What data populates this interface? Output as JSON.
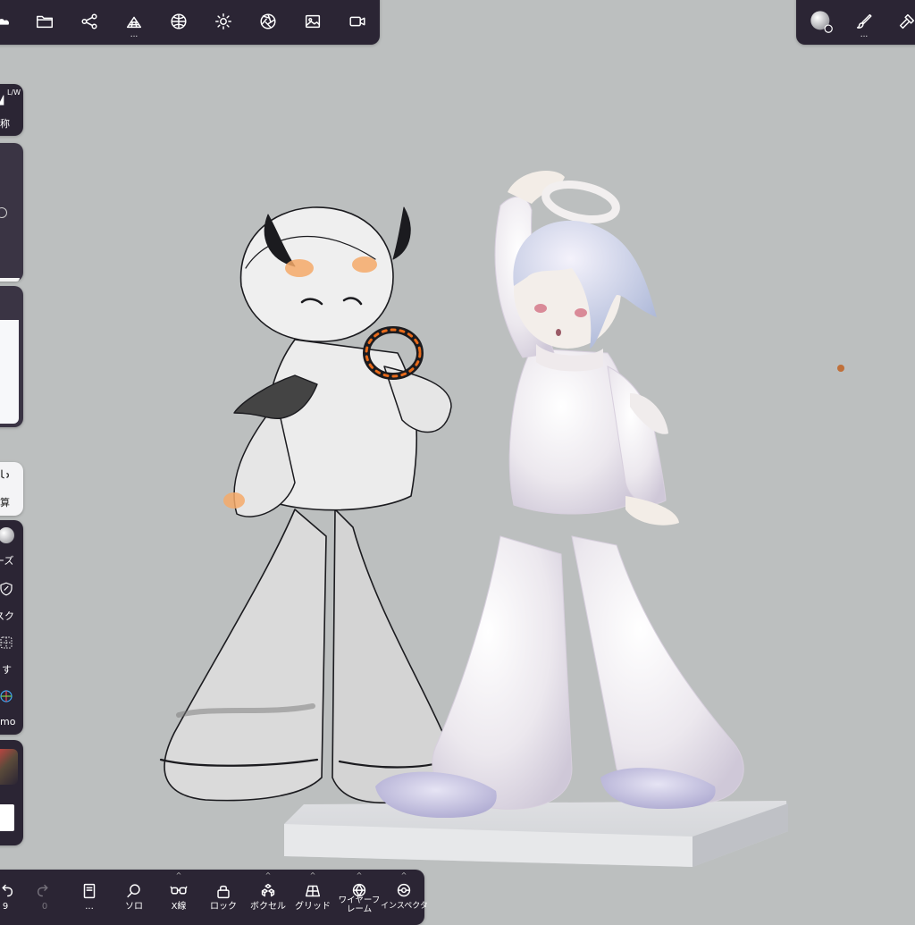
{
  "colors": {
    "background": "#bcbfbf",
    "panel": "#2b2534",
    "accent_dot": "#c0703a"
  },
  "top_toolbar": {
    "tools": [
      {
        "icon": "cloud-icon"
      },
      {
        "icon": "folder-icon"
      },
      {
        "icon": "share-nodes-icon"
      },
      {
        "icon": "mesh-stack-icon",
        "more": "..."
      },
      {
        "icon": "globe-material-icon"
      },
      {
        "icon": "sun-icon"
      },
      {
        "icon": "camera-aperture-icon"
      },
      {
        "icon": "image-icon"
      },
      {
        "icon": "video-camera-icon"
      }
    ]
  },
  "top_right_toolbar": {
    "material_more": "...",
    "tools": [
      {
        "icon": "material-ball-icon"
      },
      {
        "icon": "paint-brush-icon"
      },
      {
        "icon": "hammer-icon"
      }
    ]
  },
  "left_sidebar": {
    "symmetry_badge": "L/W",
    "symmetry_label": "称",
    "calc_label": "算",
    "items": [
      {
        "label": "ーズ"
      },
      {
        "label": "スク"
      },
      {
        "label": "す"
      },
      {
        "label": "mo"
      }
    ]
  },
  "bottom_toolbar": {
    "items": [
      {
        "label": "9",
        "icon": "undo-icon"
      },
      {
        "label": "0",
        "icon": "redo-icon"
      },
      {
        "label": "...",
        "icon": "book-icon"
      },
      {
        "label": "ソロ",
        "icon": "search-icon"
      },
      {
        "label": "X線",
        "icon": "xray-glasses-icon"
      },
      {
        "label": "ロック",
        "icon": "lock-icon"
      },
      {
        "label": "ボクセル",
        "icon": "voxel-icon"
      },
      {
        "label": "グリッド",
        "icon": "grid-icon"
      },
      {
        "label": "ワイヤーフ\nレーム",
        "icon": "wireframe-icon"
      },
      {
        "label": "インスペクタ",
        "icon": "inspector-eye-icon"
      }
    ]
  }
}
